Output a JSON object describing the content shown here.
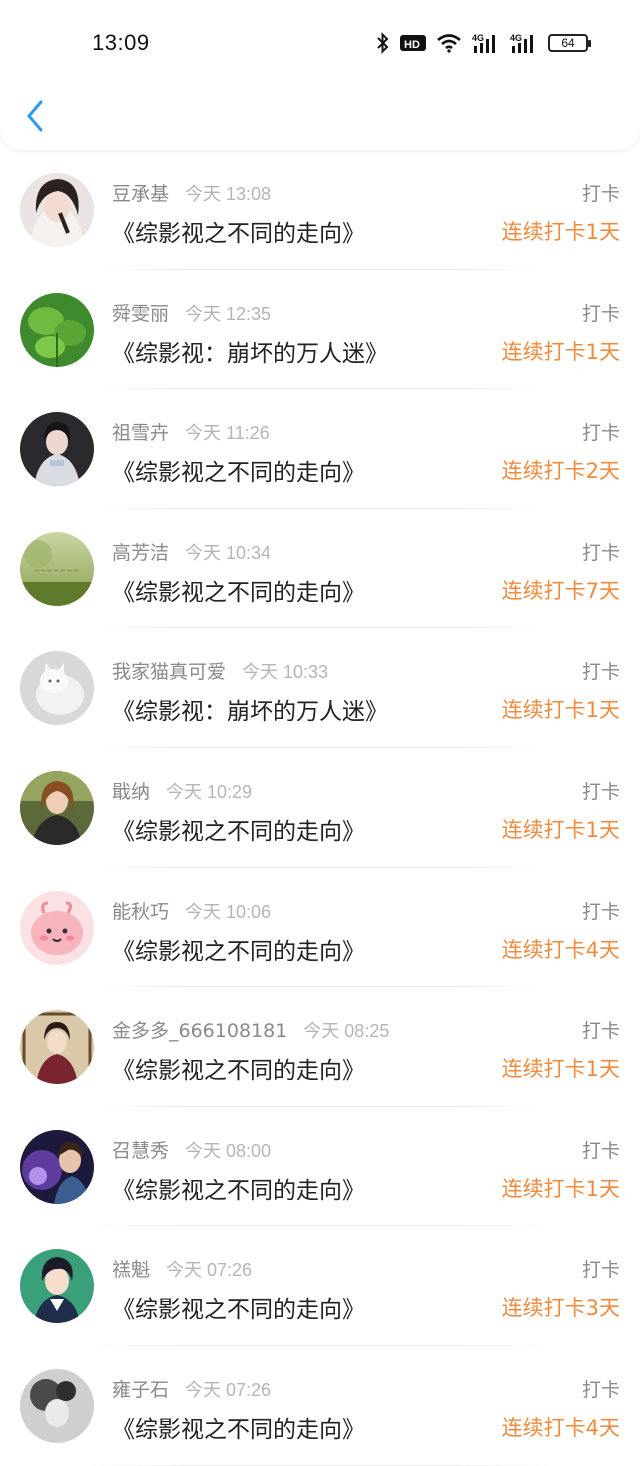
{
  "status_bar": {
    "time": "13:09",
    "hd_label": "HD",
    "network_1": "4G",
    "network_2": "4G",
    "battery": "64"
  },
  "header": {
    "back_icon": "chevron-left-icon",
    "accent": "#2b9af3"
  },
  "colors": {
    "streak": "#f08a3c",
    "name": "#8a8a8a",
    "time": "#b5b5b5",
    "book": "#222222"
  },
  "items": [
    {
      "name": "豆承基",
      "time": "今天 13:08",
      "book": "《综影视之不同的走向》",
      "action": "打卡",
      "streak": "连续打卡1天",
      "avatar": "girl-portrait"
    },
    {
      "name": "舜雯丽",
      "time": "今天 12:35",
      "book": "《综影视：崩坏的万人迷》",
      "action": "打卡",
      "streak": "连续打卡1天",
      "avatar": "green-leaves"
    },
    {
      "name": "祖雪卉",
      "time": "今天 11:26",
      "book": "《综影视之不同的走向》",
      "action": "打卡",
      "streak": "连续打卡2天",
      "avatar": "costume-woman"
    },
    {
      "name": "高芳洁",
      "time": "今天 10:34",
      "book": "《综影视之不同的走向》",
      "action": "打卡",
      "streak": "连续打卡7天",
      "avatar": "green-landscape"
    },
    {
      "name": "我家猫真可爱",
      "time": "今天 10:33",
      "book": "《综影视：崩坏的万人迷》",
      "action": "打卡",
      "streak": "连续打卡1天",
      "avatar": "white-cat"
    },
    {
      "name": "戢纳",
      "time": "今天 10:29",
      "book": "《综影视之不同的走向》",
      "action": "打卡",
      "streak": "连续打卡1天",
      "avatar": "woman-outdoor"
    },
    {
      "name": "能秋巧",
      "time": "今天 10:06",
      "book": "《综影视之不同的走向》",
      "action": "打卡",
      "streak": "连续打卡4天",
      "avatar": "pink-cartoon"
    },
    {
      "name": "金多多_666108181",
      "time": "今天 08:25",
      "book": "《综影视之不同的走向》",
      "action": "打卡",
      "streak": "连续打卡1天",
      "avatar": "vintage-portrait"
    },
    {
      "name": "召慧秀",
      "time": "今天 08:00",
      "book": "《综影视之不同的走向》",
      "action": "打卡",
      "streak": "连续打卡1天",
      "avatar": "man-purple-light"
    },
    {
      "name": "禚魁",
      "time": "今天 07:26",
      "book": "《综影视之不同的走向》",
      "action": "打卡",
      "streak": "连续打卡3天",
      "avatar": "anime-boy"
    },
    {
      "name": "雍子石",
      "time": "今天 07:26",
      "book": "《综影视之不同的走向》",
      "action": "打卡",
      "streak": "连续打卡4天",
      "avatar": "bw-portrait"
    }
  ]
}
